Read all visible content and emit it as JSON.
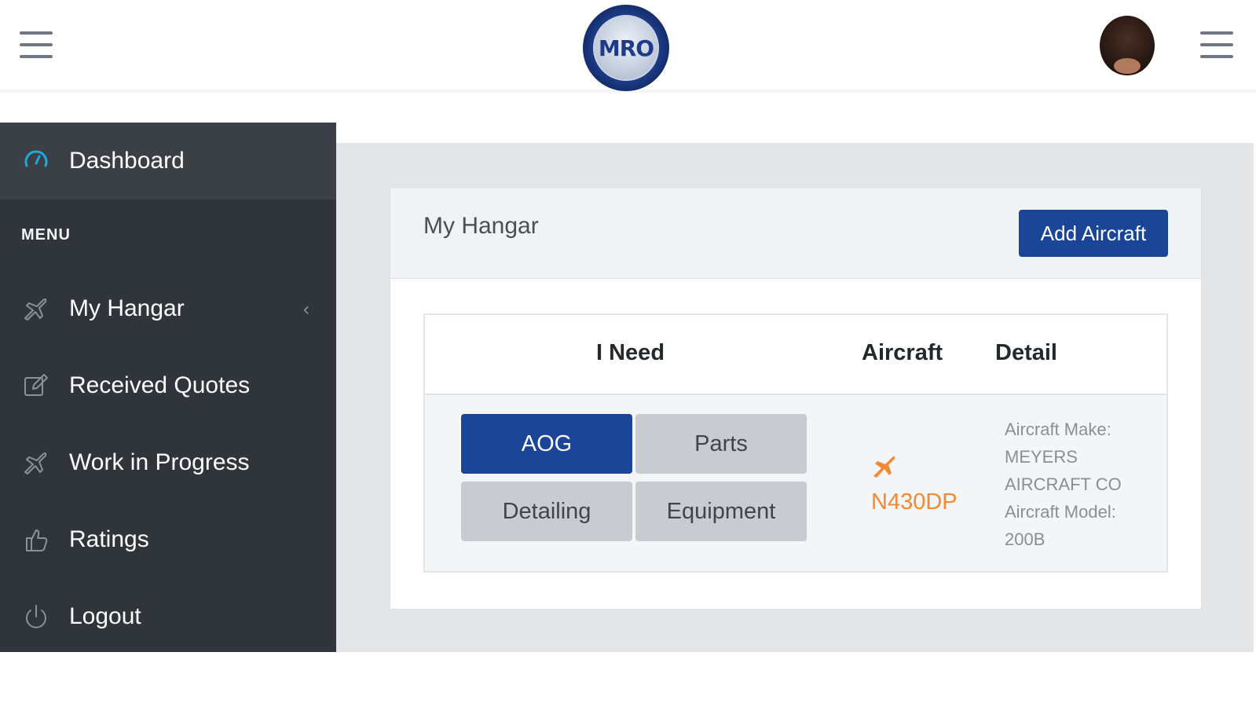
{
  "header": {
    "logo_text": "MRO",
    "left_menu_icon": "hamburger-menu-icon",
    "right_menu_icon": "hamburger-menu-icon",
    "avatar": "user-avatar"
  },
  "sidebar": {
    "dashboard": {
      "label": "Dashboard",
      "icon": "speedometer-icon"
    },
    "heading": "MENU",
    "items": [
      {
        "label": "My Hangar",
        "icon": "plane-icon",
        "caret": "‹"
      },
      {
        "label": "Received Quotes",
        "icon": "edit-icon"
      },
      {
        "label": "Work in Progress",
        "icon": "plane-icon"
      },
      {
        "label": "Ratings",
        "icon": "thumbs-up-icon"
      },
      {
        "label": "Logout",
        "icon": "power-icon"
      }
    ]
  },
  "main": {
    "card_title": "My Hangar",
    "add_button": "Add Aircraft",
    "table": {
      "headers": {
        "need": "I Need",
        "aircraft": "Aircraft",
        "detail": "Detail"
      },
      "row": {
        "needs": [
          "AOG",
          "Parts",
          "Detailing",
          "Equipment"
        ],
        "active_need": "AOG",
        "aircraft_icon": "plane-icon",
        "aircraft_id": "N430DP",
        "detail_lines": [
          "Aircraft Make:",
          "MEYERS",
          "AIRCRAFT CO",
          "Aircraft Model:",
          "200B"
        ]
      }
    }
  },
  "colors": {
    "primary": "#1b4596",
    "sidebar_bg": "#2f353b",
    "accent_orange": "#f08a36",
    "dashboard_icon": "#20a8d8"
  }
}
